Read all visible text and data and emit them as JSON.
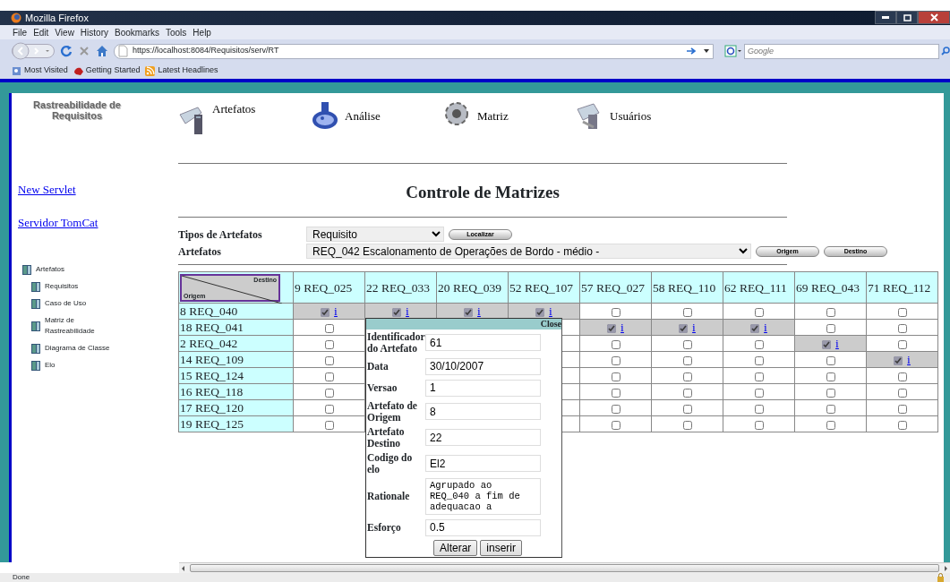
{
  "window": {
    "title": "Mozilla Firefox"
  },
  "menu": [
    "File",
    "Edit",
    "View",
    "History",
    "Bookmarks",
    "Tools",
    "Help"
  ],
  "address": {
    "url": "https://localhost:8084/Requisitos/serv/RT"
  },
  "search": {
    "placeholder": "Google"
  },
  "bookmarks": [
    "Most Visited",
    "Getting Started",
    "Latest Headlines"
  ],
  "page": {
    "logo": "Rastreabilidade de Requisitos",
    "nav": [
      "Artefatos",
      "Análise",
      "Matriz",
      "Usuários"
    ],
    "links": [
      "New Servlet",
      "Servidor TomCat"
    ],
    "tree": [
      {
        "label": "Artefatos",
        "children": [
          {
            "label": "Requisitos"
          },
          {
            "label": "Caso de Uso"
          },
          {
            "label": "Matriz de Rastreabilidade"
          },
          {
            "label": "Diagrama de Classe"
          },
          {
            "label": "Elo"
          }
        ]
      }
    ],
    "title": "Controle de Matrizes",
    "filters": [
      {
        "label": "Tipos de Artefatos",
        "value": "Requisito",
        "buttons": [
          "Localizar"
        ]
      },
      {
        "label": "Artefatos",
        "value": "REQ_042 Escalonamento de Operações de Bordo - médio -",
        "buttons": [
          "Origem",
          "Destino"
        ]
      }
    ],
    "matrix": {
      "corner": {
        "top": "Destino",
        "bottom": "Origem"
      },
      "columns": [
        "9 REQ_025",
        "22 REQ_033",
        "20 REQ_039",
        "52 REQ_107",
        "57 REQ_027",
        "58 REQ_110",
        "62 REQ_111",
        "69 REQ_043",
        "71 REQ_112"
      ],
      "rows": [
        {
          "label": "8 REQ_040",
          "cells": [
            {
              "checked": true,
              "link": "i"
            },
            {
              "checked": true,
              "link": "i"
            },
            {
              "checked": true,
              "link": "i"
            },
            {
              "checked": true,
              "link": "i"
            },
            {
              "checked": false
            },
            {
              "checked": false
            },
            {
              "checked": false
            },
            {
              "checked": false
            },
            {
              "checked": false
            }
          ]
        },
        {
          "label": "18 REQ_041",
          "cells": [
            {
              "checked": false
            },
            null,
            null,
            null,
            {
              "checked": true,
              "link": "i"
            },
            {
              "checked": true,
              "link": "i"
            },
            {
              "checked": true,
              "link": "i"
            },
            {
              "checked": false
            },
            {
              "checked": false
            }
          ]
        },
        {
          "label": "2 REQ_042",
          "cells": [
            {
              "checked": false
            },
            null,
            null,
            null,
            {
              "checked": false
            },
            {
              "checked": false
            },
            {
              "checked": false
            },
            {
              "checked": true,
              "link": "i"
            },
            {
              "checked": false
            }
          ]
        },
        {
          "label": "14 REQ_109",
          "cells": [
            {
              "checked": false
            },
            null,
            null,
            null,
            {
              "checked": false
            },
            {
              "checked": false
            },
            {
              "checked": false
            },
            {
              "checked": false
            },
            {
              "checked": true,
              "link": "i"
            }
          ]
        },
        {
          "label": "15 REQ_124",
          "cells": [
            {
              "checked": false
            },
            null,
            null,
            null,
            {
              "checked": false
            },
            {
              "checked": false
            },
            {
              "checked": false
            },
            {
              "checked": false
            },
            {
              "checked": false
            }
          ]
        },
        {
          "label": "16 REQ_118",
          "cells": [
            {
              "checked": false
            },
            null,
            null,
            null,
            {
              "checked": false
            },
            {
              "checked": false
            },
            {
              "checked": false
            },
            {
              "checked": false
            },
            {
              "checked": false
            }
          ]
        },
        {
          "label": "17 REQ_120",
          "cells": [
            {
              "checked": false
            },
            null,
            null,
            null,
            {
              "checked": false
            },
            {
              "checked": false
            },
            {
              "checked": false
            },
            {
              "checked": false
            },
            {
              "checked": false
            }
          ]
        },
        {
          "label": "19 REQ_125",
          "cells": [
            {
              "checked": false
            },
            null,
            null,
            null,
            {
              "checked": false
            },
            {
              "checked": false
            },
            {
              "checked": false
            },
            {
              "checked": false
            },
            {
              "checked": false
            }
          ]
        }
      ]
    },
    "popup": {
      "close": "Close",
      "fields": [
        {
          "label": "Identificador do Artefato",
          "value": "61",
          "kind": "input"
        },
        {
          "label": "Data",
          "value": "30/10/2007",
          "kind": "input"
        },
        {
          "label": "Versao",
          "value": "1",
          "kind": "input"
        },
        {
          "label": "Artefato de Origem",
          "value": "8",
          "kind": "input"
        },
        {
          "label": "Artefato Destino",
          "value": "22",
          "kind": "input"
        },
        {
          "label": "Codigo do elo",
          "value": "El2",
          "kind": "input"
        },
        {
          "label": "Rationale",
          "value": "Agrupado ao REQ_040 a fim de adequacao a",
          "kind": "textarea"
        },
        {
          "label": "Esforço",
          "value": "0.5",
          "kind": "input"
        }
      ],
      "buttons": [
        "Alterar",
        "inserir"
      ]
    }
  },
  "status_bar": {
    "text": "Done"
  }
}
